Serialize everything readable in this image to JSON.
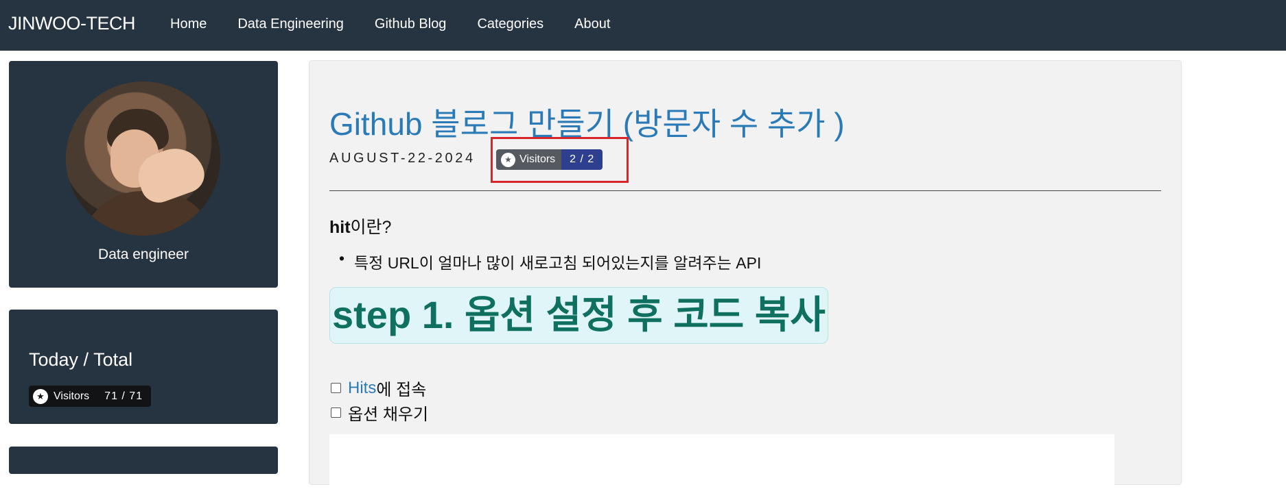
{
  "header": {
    "brand": "JINWOO-TECH",
    "nav": [
      "Home",
      "Data Engineering",
      "Github Blog",
      "Categories",
      "About"
    ]
  },
  "sidebar": {
    "profile": {
      "role": "Data engineer"
    },
    "counter": {
      "title": "Today / Total",
      "badge_label": "Visitors",
      "badge_count": "71 / 71"
    }
  },
  "post": {
    "title": "Github 블로그 만들기 (방문자 수 추가 )",
    "date": "AUGUST-22-2024",
    "badge_label": "Visitors",
    "badge_count": "2 / 2",
    "hit_bold": "hit",
    "hit_rest": "이란?",
    "bullet": "특정 URL이 얼마나 많이 새로고침 되어있는지를 알려주는 API",
    "step_heading": "step 1. 옵션 설정 후 코드 복사",
    "checklist": [
      {
        "link": "Hits",
        "text": "에 접속"
      },
      {
        "text": "옵션 채우기"
      }
    ]
  },
  "colors": {
    "topbar": "#263340",
    "link": "#2a7ab8",
    "highlight_border": "#d9242a",
    "step_text": "#0f7060"
  }
}
